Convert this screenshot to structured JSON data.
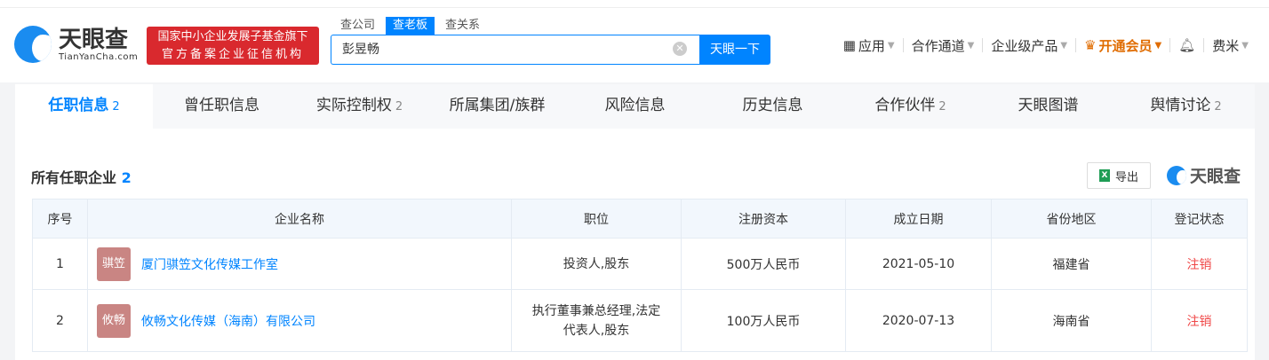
{
  "header": {
    "logo_cn": "天眼查",
    "logo_en": "TianYanCha.com",
    "badge_line1": "国家中小企业发展子基金旗下",
    "badge_line2": "官方备案企业征信机构",
    "search_tabs": [
      "查公司",
      "查老板",
      "查关系"
    ],
    "search_value": "彭昱畅",
    "search_button": "天眼一下",
    "nav": {
      "apps": "应用",
      "channel": "合作通道",
      "products": "企业级产品",
      "vip": "开通会员",
      "user": "费米"
    }
  },
  "tabs": [
    {
      "label": "任职信息",
      "count": "2"
    },
    {
      "label": "曾任职信息",
      "count": ""
    },
    {
      "label": "实际控制权",
      "count": "2"
    },
    {
      "label": "所属集团/族群",
      "count": ""
    },
    {
      "label": "风险信息",
      "count": ""
    },
    {
      "label": "历史信息",
      "count": ""
    },
    {
      "label": "合作伙伴",
      "count": "2"
    },
    {
      "label": "天眼图谱",
      "count": ""
    },
    {
      "label": "舆情讨论",
      "count": "2"
    }
  ],
  "section": {
    "title": "所有任职企业",
    "count": "2",
    "export": "导出",
    "brand": "天眼查"
  },
  "table": {
    "headers": [
      "序号",
      "企业名称",
      "职位",
      "注册资本",
      "成立日期",
      "省份地区",
      "登记状态"
    ],
    "rows": [
      {
        "no": "1",
        "avatar": "骐笠",
        "name": "厦门骐笠文化传媒工作室",
        "role": "投资人,股东",
        "capital": "500万人民币",
        "date": "2021-05-10",
        "region": "福建省",
        "status": "注销"
      },
      {
        "no": "2",
        "avatar": "攸畅",
        "name": "攸畅文化传媒（海南）有限公司",
        "role": "执行董事兼总经理,法定代表人,股东",
        "capital": "100万人民币",
        "date": "2020-07-13",
        "region": "海南省",
        "status": "注销"
      }
    ]
  }
}
